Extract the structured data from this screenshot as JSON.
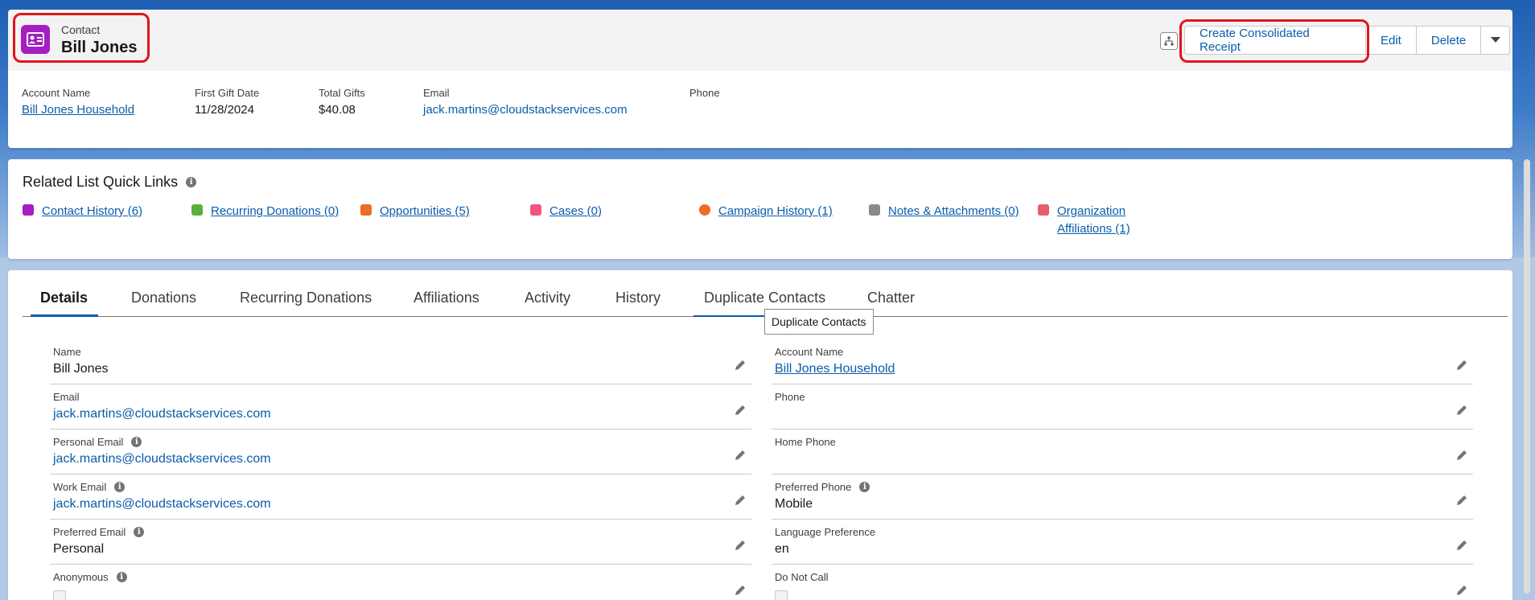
{
  "colors": {
    "accent": "#0b5cab",
    "contact_icon": "#a41ec2",
    "highlight_outline": "#e0141e"
  },
  "header": {
    "object_type": "Contact",
    "record_name": "Bill Jones",
    "buttons": {
      "consolidated_receipt": "Create Consolidated Receipt",
      "edit": "Edit",
      "delete": "Delete"
    },
    "highlights": [
      {
        "label": "Account Name",
        "value": "Bill Jones Household"
      },
      {
        "label": "First Gift Date",
        "value": "11/28/2024"
      },
      {
        "label": "Total Gifts",
        "value": "$40.08"
      },
      {
        "label": "Email",
        "value": "jack.martins@cloudstackservices.com"
      },
      {
        "label": "Phone",
        "value": ""
      }
    ]
  },
  "quick_links": {
    "title": "Related List Quick Links",
    "items": [
      {
        "label": "Contact History (6)",
        "icon": "contact-history-icon",
        "color": "#a41ec2"
      },
      {
        "label": "Recurring Donations (0)",
        "icon": "recurring-donations-icon",
        "color": "#5aae3c"
      },
      {
        "label": "Opportunities (5)",
        "icon": "opportunities-icon",
        "color": "#f06a28"
      },
      {
        "label": "Cases (0)",
        "icon": "cases-icon",
        "color": "#f2547e"
      },
      {
        "label": "Campaign History (1)",
        "icon": "campaign-history-icon",
        "color": "#f06a28"
      },
      {
        "label": "Notes & Attachments (0)",
        "icon": "notes-attachments-icon",
        "color": "#8a8a8a"
      },
      {
        "label_line1": "Organization",
        "label_line2": "Affiliations (1)",
        "icon": "organization-affiliations-icon",
        "color": "#e3616a"
      }
    ]
  },
  "tabs": [
    "Details",
    "Donations",
    "Recurring Donations",
    "Affiliations",
    "Activity",
    "History",
    "Duplicate Contacts",
    "Chatter"
  ],
  "tooltip": "Duplicate Contacts",
  "details": {
    "left": [
      {
        "label": "Name",
        "value": "Bill Jones"
      },
      {
        "label": "Email",
        "value": "jack.martins@cloudstackservices.com"
      },
      {
        "label": "Personal Email",
        "value": "jack.martins@cloudstackservices.com"
      },
      {
        "label": "Work Email",
        "value": "jack.martins@cloudstackservices.com"
      },
      {
        "label": "Preferred Email",
        "value": "Personal"
      },
      {
        "label": "Anonymous",
        "value": ""
      }
    ],
    "right": [
      {
        "label": "Account Name",
        "value": "Bill Jones Household"
      },
      {
        "label": "Phone",
        "value": ""
      },
      {
        "label": "Home Phone",
        "value": ""
      },
      {
        "label": "Preferred Phone",
        "value": "Mobile"
      },
      {
        "label": "Language Preference",
        "value": "en"
      },
      {
        "label": "Do Not Call",
        "value": ""
      }
    ]
  }
}
